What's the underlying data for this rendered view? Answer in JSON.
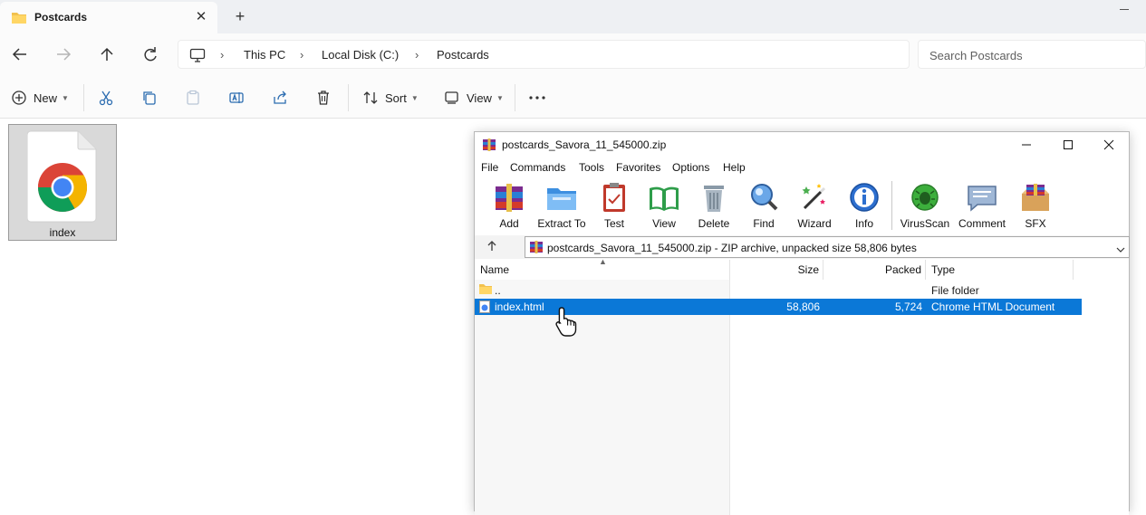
{
  "explorer": {
    "tab_title": "Postcards",
    "breadcrumb": [
      "This PC",
      "Local Disk (C:)",
      "Postcards"
    ],
    "search_placeholder": "Search Postcards",
    "commands": {
      "new": "New",
      "sort": "Sort",
      "view": "View"
    },
    "files": [
      {
        "name": "index"
      }
    ]
  },
  "winrar": {
    "title": "postcards_Savora_11_545000.zip",
    "menu": [
      "File",
      "Commands",
      "Tools",
      "Favorites",
      "Options",
      "Help"
    ],
    "toolbar": [
      "Add",
      "Extract To",
      "Test",
      "View",
      "Delete",
      "Find",
      "Wizard",
      "Info",
      "VirusScan",
      "Comment",
      "SFX"
    ],
    "path": "postcards_Savora_11_545000.zip - ZIP archive, unpacked size 58,806 bytes",
    "columns": {
      "name": "Name",
      "size": "Size",
      "packed": "Packed",
      "type": "Type"
    },
    "rows": [
      {
        "name": "..",
        "size": "",
        "packed": "",
        "type": "File folder"
      },
      {
        "name": "index.html",
        "size": "58,806",
        "packed": "5,724",
        "type": "Chrome HTML Document"
      }
    ]
  }
}
